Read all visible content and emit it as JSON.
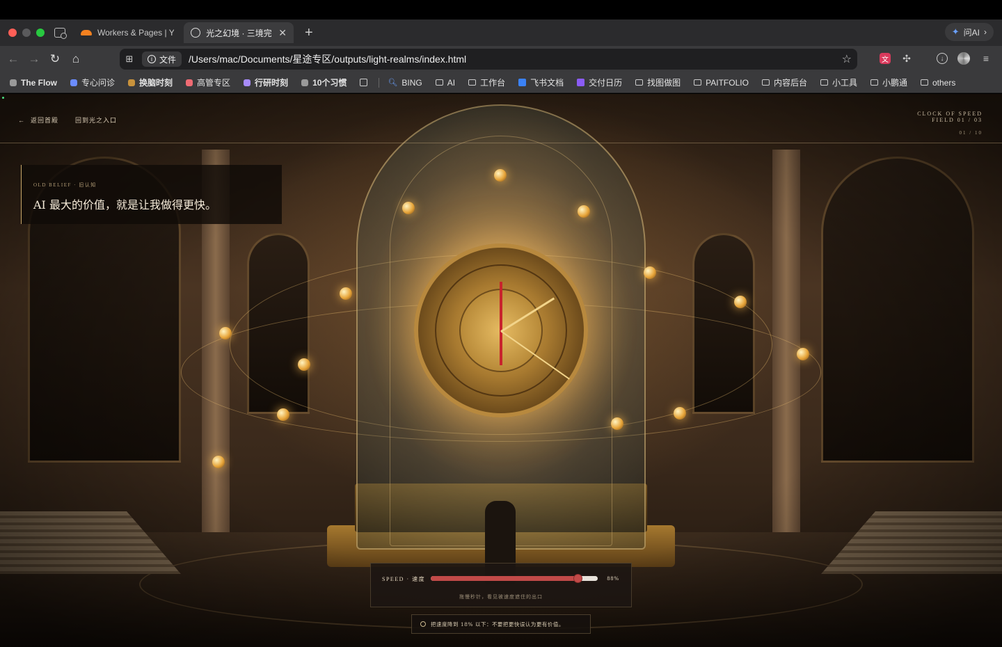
{
  "browser": {
    "tabs": [
      {
        "title": "Workers & Pages | Yor",
        "icon": "cloudflare-icon",
        "active": false
      },
      {
        "title": "光之幻境 · 三境完整",
        "icon": "globe-icon",
        "active": true
      }
    ],
    "ai_button": "问AI",
    "url_chip": "文件",
    "url": "/Users/mac/Documents/星途专区/outputs/light-realms/index.html",
    "bookmarks": [
      {
        "label": "The Flow",
        "color": "#9a9a9a",
        "kind": "dot",
        "bold": true
      },
      {
        "label": "专心问诊",
        "color": "#6b8cff",
        "kind": "dot",
        "bold": false
      },
      {
        "label": "换脑时刻",
        "color": "#c8923c",
        "kind": "dot",
        "bold": true
      },
      {
        "label": "高管专区",
        "color": "#ef6b73",
        "kind": "dot",
        "bold": false
      },
      {
        "label": "行研时刻",
        "color": "#a78bfa",
        "kind": "dot",
        "bold": true
      },
      {
        "label": "10个习惯",
        "color": "#9a9a9a",
        "kind": "dot",
        "bold": true
      },
      {
        "label": "BING",
        "kind": "search"
      },
      {
        "label": "AI",
        "kind": "folder"
      },
      {
        "label": "工作台",
        "kind": "folder"
      },
      {
        "label": "飞书文档",
        "kind": "feishu"
      },
      {
        "label": "交付日历",
        "kind": "calendar"
      },
      {
        "label": "找图做图",
        "kind": "folder"
      },
      {
        "label": "PAITFOLIO",
        "kind": "folder"
      },
      {
        "label": "内容后台",
        "kind": "folder"
      },
      {
        "label": "小工具",
        "kind": "folder"
      },
      {
        "label": "小鹏通",
        "kind": "folder"
      },
      {
        "label": "others",
        "kind": "folder"
      }
    ]
  },
  "page": {
    "nav": {
      "back": "返回首殿",
      "realm": "回到光之入口",
      "arrow": "←"
    },
    "field": {
      "title": "CLOCK OF SPEED",
      "subtitle": "FIELD 01 / 03",
      "counter": "01 / 10"
    },
    "belief": {
      "tag": "OLD BELIEF · 旧认知",
      "text": "AI 最大的价值，就是让我做得更快。"
    },
    "speed": {
      "label": "SPEED · 速度",
      "value": 0.88,
      "value_text": "88%",
      "hint": "拖慢秒针，看见被速度遮住的出口"
    },
    "goal": {
      "text": "把速度降到 18% 以下：不要把更快误认为更有价值。"
    }
  }
}
